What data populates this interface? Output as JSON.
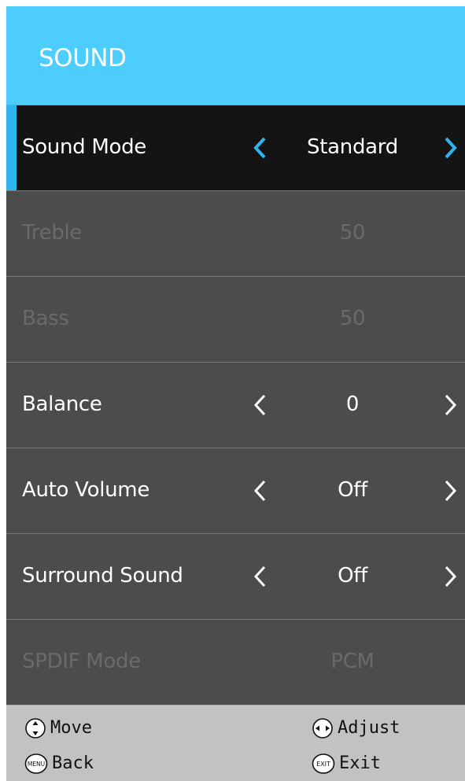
{
  "header": {
    "title": "SOUND"
  },
  "rows": [
    {
      "label": "Sound Mode",
      "value": "Standard",
      "has_arrows": true,
      "state": "selected"
    },
    {
      "label": "Treble",
      "value": "50",
      "has_arrows": false,
      "state": "disabled"
    },
    {
      "label": "Bass",
      "value": "50",
      "has_arrows": false,
      "state": "disabled"
    },
    {
      "label": "Balance",
      "value": "0",
      "has_arrows": true,
      "state": "normal"
    },
    {
      "label": "Auto Volume",
      "value": "Off",
      "has_arrows": true,
      "state": "normal"
    },
    {
      "label": "Surround Sound",
      "value": "Off",
      "has_arrows": true,
      "state": "normal"
    },
    {
      "label": "SPDIF Mode",
      "value": "PCM",
      "has_arrows": false,
      "state": "disabled"
    }
  ],
  "footer": {
    "move": {
      "label": "Move",
      "icon": "up-down-icon"
    },
    "back": {
      "label": "Back",
      "icon": "menu-button-icon",
      "icon_text": "MENU"
    },
    "adjust": {
      "label": "Adjust",
      "icon": "left-right-icon"
    },
    "exit": {
      "label": "Exit",
      "icon": "exit-button-icon",
      "icon_text": "EXIT"
    }
  },
  "colors": {
    "header_bg": "#4ccdfd",
    "selected_bg": "#141414",
    "selected_accent": "#2fb6ee",
    "row_bg": "#4c4c4c",
    "disabled_text": "#6a6a6a",
    "footer_bg": "#c2c2c2"
  }
}
